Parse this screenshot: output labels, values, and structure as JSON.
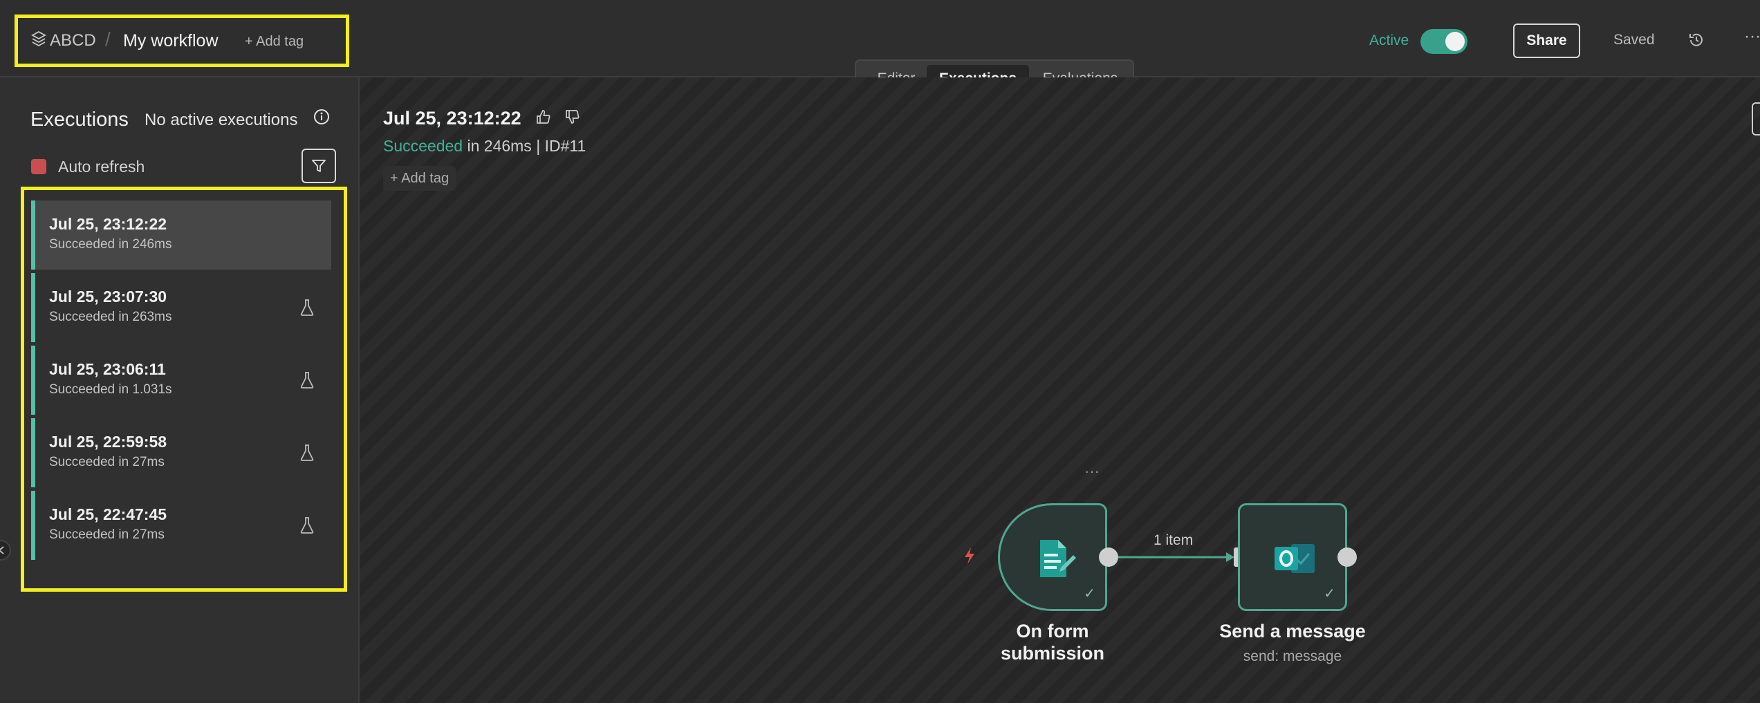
{
  "header": {
    "project_name": "ABCD",
    "separator": "/",
    "workflow_name": "My workflow",
    "add_tag": "+ Add tag",
    "tabs": [
      {
        "label": "Editor"
      },
      {
        "label": "Executions",
        "active": true
      },
      {
        "label": "Evaluations"
      }
    ],
    "active_label": "Active",
    "active_toggle_on": true,
    "share_label": "Share",
    "saved_label": "Saved",
    "more_label": "···"
  },
  "sidebar": {
    "title": "Executions",
    "no_active": "No active executions",
    "auto_refresh_label": "Auto refresh",
    "auto_refresh_checked": true,
    "executions": [
      {
        "time": "Jul 25, 23:12:22",
        "status": "Succeeded in 246ms",
        "selected": true
      },
      {
        "time": "Jul 25, 23:07:30",
        "status": "Succeeded in 263ms"
      },
      {
        "time": "Jul 25, 23:06:11",
        "status": "Succeeded in 1.031s"
      },
      {
        "time": "Jul 25, 22:59:58",
        "status": "Succeeded in 27ms"
      },
      {
        "time": "Jul 25, 22:47:45",
        "status": "Succeeded in 27ms"
      }
    ]
  },
  "run": {
    "time": "Jul 25, 23:12:22",
    "status": "Succeeded",
    "details": " in 246ms | ID#11",
    "add_tag": "+   Add tag"
  },
  "nodes": {
    "form": {
      "label": "On form submission",
      "icon": "form-document-icon"
    },
    "message": {
      "label": "Send a message",
      "sub": "send: message",
      "icon": "outlook-icon"
    },
    "connection_label": "1 item",
    "node_menu": "···"
  },
  "colors": {
    "accent": "#3fb39b",
    "highlight": "#f2ee1f",
    "node_border": "#4fa78f",
    "trigger": "#d9534f"
  }
}
